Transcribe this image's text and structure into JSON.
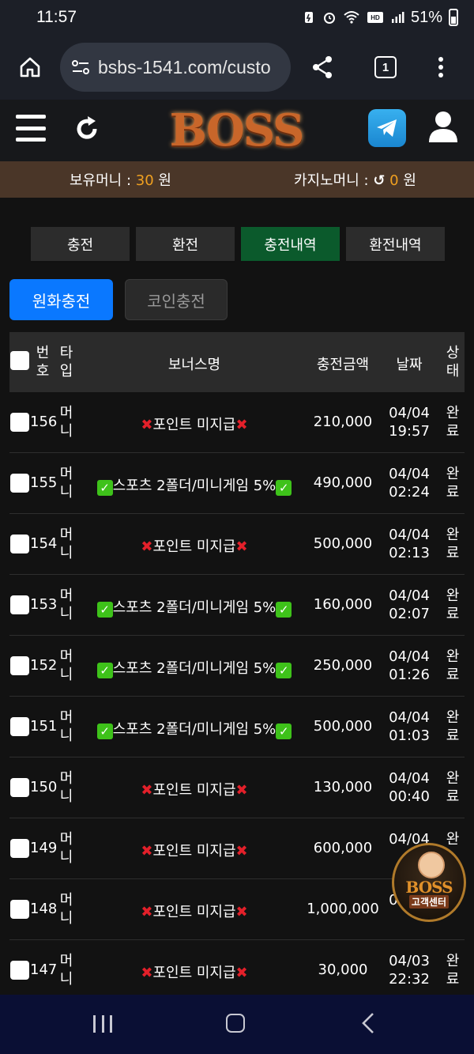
{
  "status_bar": {
    "time": "11:57",
    "battery": "51%"
  },
  "browser": {
    "url": "bsbs-1541.com/custo",
    "tab_count": "1"
  },
  "site": {
    "logo": "BOSS",
    "balance_label": "보유머니 :",
    "balance_value": "30",
    "currency": "원",
    "casino_label": "카지노머니 :",
    "casino_value": "0",
    "casino_currency": "원"
  },
  "nav_tabs": [
    {
      "label": "충전",
      "active": false
    },
    {
      "label": "환전",
      "active": false
    },
    {
      "label": "충전내역",
      "active": true
    },
    {
      "label": "환전내역",
      "active": false
    }
  ],
  "sub_tabs": {
    "krw": "원화충전",
    "coin": "코인충전"
  },
  "table": {
    "headers": {
      "num_1": "번",
      "num_2": "호",
      "type_1": "타",
      "type_2": "입",
      "bonus": "보너스명",
      "amount": "충전금액",
      "date": "날짜",
      "status_1": "상",
      "status_2": "태"
    },
    "rows": [
      {
        "num": "156",
        "type_1": "머",
        "type_2": "니",
        "bonus": "포인트 미지급",
        "bonus_kind": "x",
        "amount": "210,000",
        "date": "04/04",
        "time": "19:57",
        "status_1": "완",
        "status_2": "료"
      },
      {
        "num": "155",
        "type_1": "머",
        "type_2": "니",
        "bonus": "스포츠 2폴더/미니게임 5%",
        "bonus_kind": "check",
        "amount": "490,000",
        "date": "04/04",
        "time": "02:24",
        "status_1": "완",
        "status_2": "료"
      },
      {
        "num": "154",
        "type_1": "머",
        "type_2": "니",
        "bonus": "포인트 미지급",
        "bonus_kind": "x",
        "amount": "500,000",
        "date": "04/04",
        "time": "02:13",
        "status_1": "완",
        "status_2": "료"
      },
      {
        "num": "153",
        "type_1": "머",
        "type_2": "니",
        "bonus": "스포츠 2폴더/미니게임 5%",
        "bonus_kind": "check",
        "amount": "160,000",
        "date": "04/04",
        "time": "02:07",
        "status_1": "완",
        "status_2": "료"
      },
      {
        "num": "152",
        "type_1": "머",
        "type_2": "니",
        "bonus": "스포츠 2폴더/미니게임 5%",
        "bonus_kind": "check",
        "amount": "250,000",
        "date": "04/04",
        "time": "01:26",
        "status_1": "완",
        "status_2": "료"
      },
      {
        "num": "151",
        "type_1": "머",
        "type_2": "니",
        "bonus": "스포츠 2폴더/미니게임 5%",
        "bonus_kind": "check",
        "amount": "500,000",
        "date": "04/04",
        "time": "01:03",
        "status_1": "완",
        "status_2": "료"
      },
      {
        "num": "150",
        "type_1": "머",
        "type_2": "니",
        "bonus": "포인트 미지급",
        "bonus_kind": "x",
        "amount": "130,000",
        "date": "04/04",
        "time": "00:40",
        "status_1": "완",
        "status_2": "료"
      },
      {
        "num": "149",
        "type_1": "머",
        "type_2": "니",
        "bonus": "포인트 미지급",
        "bonus_kind": "x",
        "amount": "600,000",
        "date": "04/04",
        "time": "",
        "status_1": "완",
        "status_2": ""
      },
      {
        "num": "148",
        "type_1": "머",
        "type_2": "니",
        "bonus": "포인트 미지급",
        "bonus_kind": "x",
        "amount": "1,000,000",
        "date": "",
        "time": "00:05",
        "status_1": "",
        "status_2": ""
      },
      {
        "num": "147",
        "type_1": "머",
        "type_2": "니",
        "bonus": "포인트 미지급",
        "bonus_kind": "x",
        "amount": "30,000",
        "date": "04/03",
        "time": "22:32",
        "status_1": "완",
        "status_2": "료"
      }
    ]
  },
  "support_badge": {
    "logo": "BOSS",
    "label": "고객센터"
  },
  "icons": {
    "home": "home-icon",
    "site_settings": "site-settings-icon",
    "share": "share-icon",
    "menu": "more-vert-icon",
    "hamburger": "hamburger-icon",
    "refresh": "refresh-icon",
    "telegram": "telegram-icon",
    "user": "user-icon"
  },
  "colors": {
    "accent_blue": "#0a78ff",
    "active_tab": "#0b5a2c",
    "balance_bar": "#4a3628",
    "amount_orange": "#f0a020",
    "x_red": "#e3202a",
    "check_green": "#3ec21a"
  }
}
